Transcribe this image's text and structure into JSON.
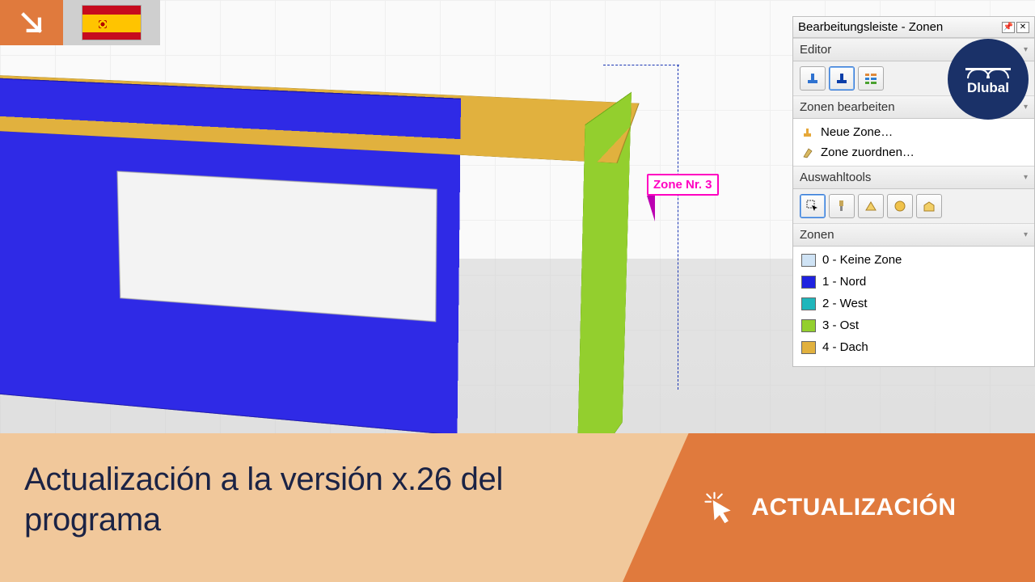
{
  "logo_text": "Dlubal",
  "viewport_label": {
    "text": "Zone Nr. 3"
  },
  "panel": {
    "title": "Bearbeitungsleiste - Zonen",
    "sections": {
      "editor": {
        "title": "Editor"
      },
      "edit_zones": {
        "title": "Zonen bearbeiten",
        "items": {
          "new_zone": "Neue Zone…",
          "assign_zone": "Zone zuordnen…"
        }
      },
      "selection_tools": {
        "title": "Auswahltools"
      },
      "zones": {
        "title": "Zonen",
        "items": [
          {
            "label": "0 - Keine Zone",
            "color": "#cfe3f5"
          },
          {
            "label": "1 - Nord",
            "color": "#1f22e0"
          },
          {
            "label": "2 - West",
            "color": "#1fb6bb"
          },
          {
            "label": "3 - Ost",
            "color": "#93cf2e"
          },
          {
            "label": "4 - Dach",
            "color": "#e1b13e"
          }
        ]
      }
    }
  },
  "banner": {
    "headline": "Actualización a la versión x.26 del programa",
    "tag": "ACTUALIZACIÓN"
  }
}
